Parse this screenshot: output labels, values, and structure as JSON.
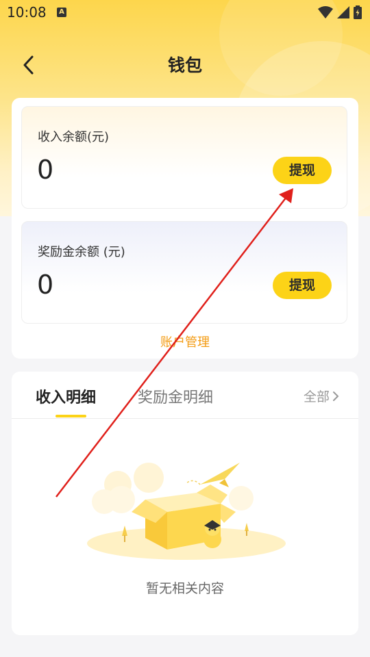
{
  "status_bar": {
    "time": "10:08",
    "a_icon": "A"
  },
  "nav": {
    "title": "钱包",
    "back_icon": "chevron-left-icon"
  },
  "wallet": {
    "income": {
      "label": "收入余额(元)",
      "value": "0",
      "button": "提现"
    },
    "bonus": {
      "label": "奖励金余额 (元)",
      "value": "0",
      "button": "提现"
    },
    "account_link": "账户管理"
  },
  "details": {
    "tabs": [
      {
        "label": "收入明细",
        "active": true
      },
      {
        "label": "奖励金明细",
        "active": false
      }
    ],
    "all_label": "全部",
    "empty_text": "暂无相关内容"
  },
  "colors": {
    "accent": "#fcd317",
    "link": "#f39b12",
    "annotation": "#e0201b"
  }
}
